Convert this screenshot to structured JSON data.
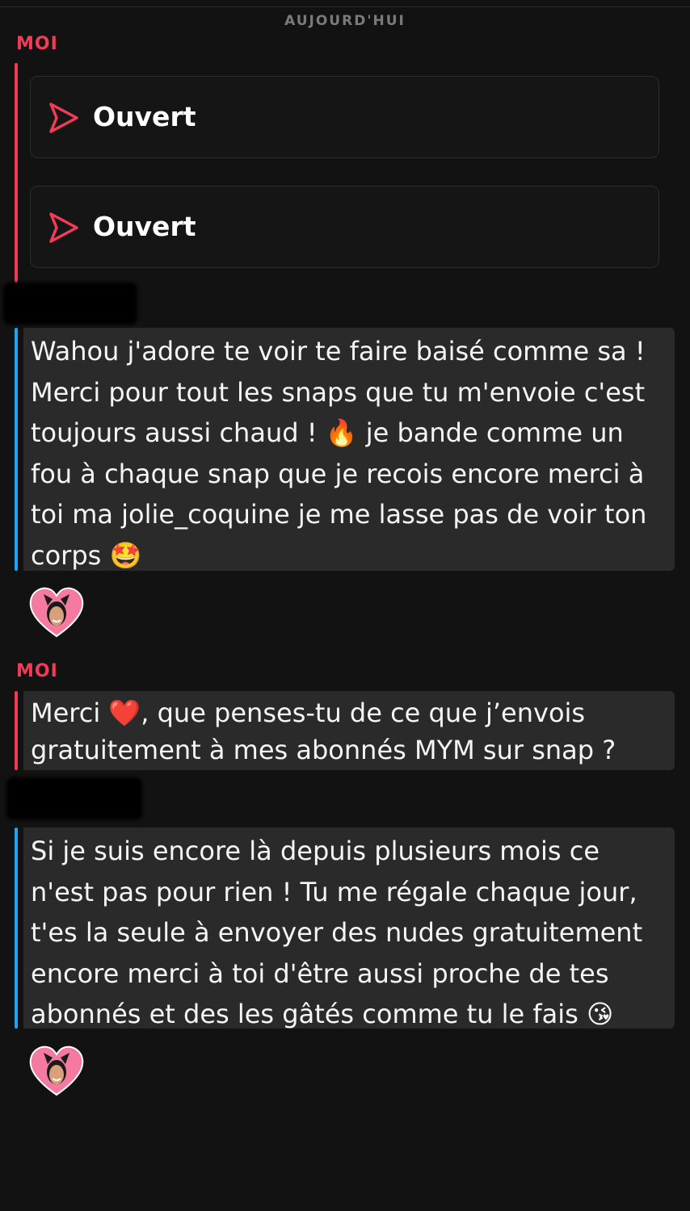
{
  "header": {
    "day_label": "AUJOURD'HUI"
  },
  "conversation": {
    "sender_me_label": "MOI",
    "snaps": [
      {
        "label": "Ouvert",
        "icon": "snap-opened-arrow-icon"
      },
      {
        "label": "Ouvert",
        "icon": "snap-opened-arrow-icon"
      }
    ],
    "messages": [
      {
        "sender": "other",
        "text": "Wahou j'adore te voir te faire baisé comme sa ! Merci pour tout les snaps que tu m'envoie c'est toujours aussi chaud ! 🔥 je bande comme un fou à chaque snap que je recois encore merci à toi ma jolie_coquine je me lasse pas de voir ton corps 🤩"
      },
      {
        "sender": "me",
        "text": "Merci ❤️, que penses-tu de ce que j’envois gratuitement à mes abonnés MYM sur snap ?"
      },
      {
        "sender": "other",
        "text": "Si je suis encore là depuis plusieurs mois ce n'est pas pour rien ! Tu me régale chaque jour, t'es la seule à envoyer des nudes gratuitement encore merci à toi d'être aussi proche de tes abonnés et des les gâtés comme tu le fais 😘"
      }
    ],
    "reaction_icon": "heart-bitmoji-reaction-icon"
  },
  "colors": {
    "background": "#121212",
    "me_accent": "#f23c57",
    "other_accent": "#1fa3f2",
    "bubble_bg": "#2a2a2a"
  }
}
